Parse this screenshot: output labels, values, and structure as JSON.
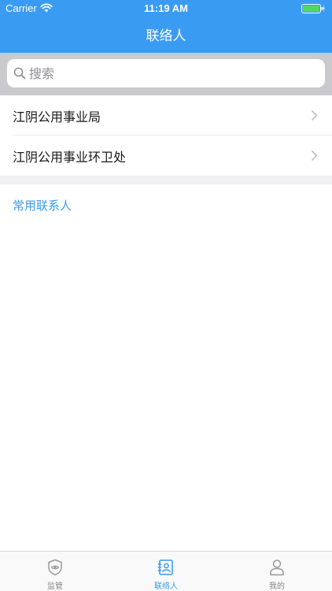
{
  "status_bar": {
    "carrier": "Carrier",
    "time": "11:19 AM"
  },
  "nav": {
    "title": "联络人"
  },
  "search": {
    "placeholder": "搜索",
    "value": ""
  },
  "list": {
    "items": [
      {
        "label": "江阴公用事业局"
      },
      {
        "label": "江阴公用事业环卫处"
      }
    ]
  },
  "section": {
    "title": "常用联系人"
  },
  "tab_bar": {
    "tabs": [
      {
        "label": "监管",
        "icon": "eye-shield-icon",
        "active": false
      },
      {
        "label": "联络人",
        "icon": "contact-card-icon",
        "active": true
      },
      {
        "label": "我的",
        "icon": "person-icon",
        "active": false
      }
    ]
  },
  "colors": {
    "primary": "#3a9bf3",
    "search_bg": "#c9c9ce",
    "section_gap": "#efeff4",
    "battery": "#4cd964"
  }
}
